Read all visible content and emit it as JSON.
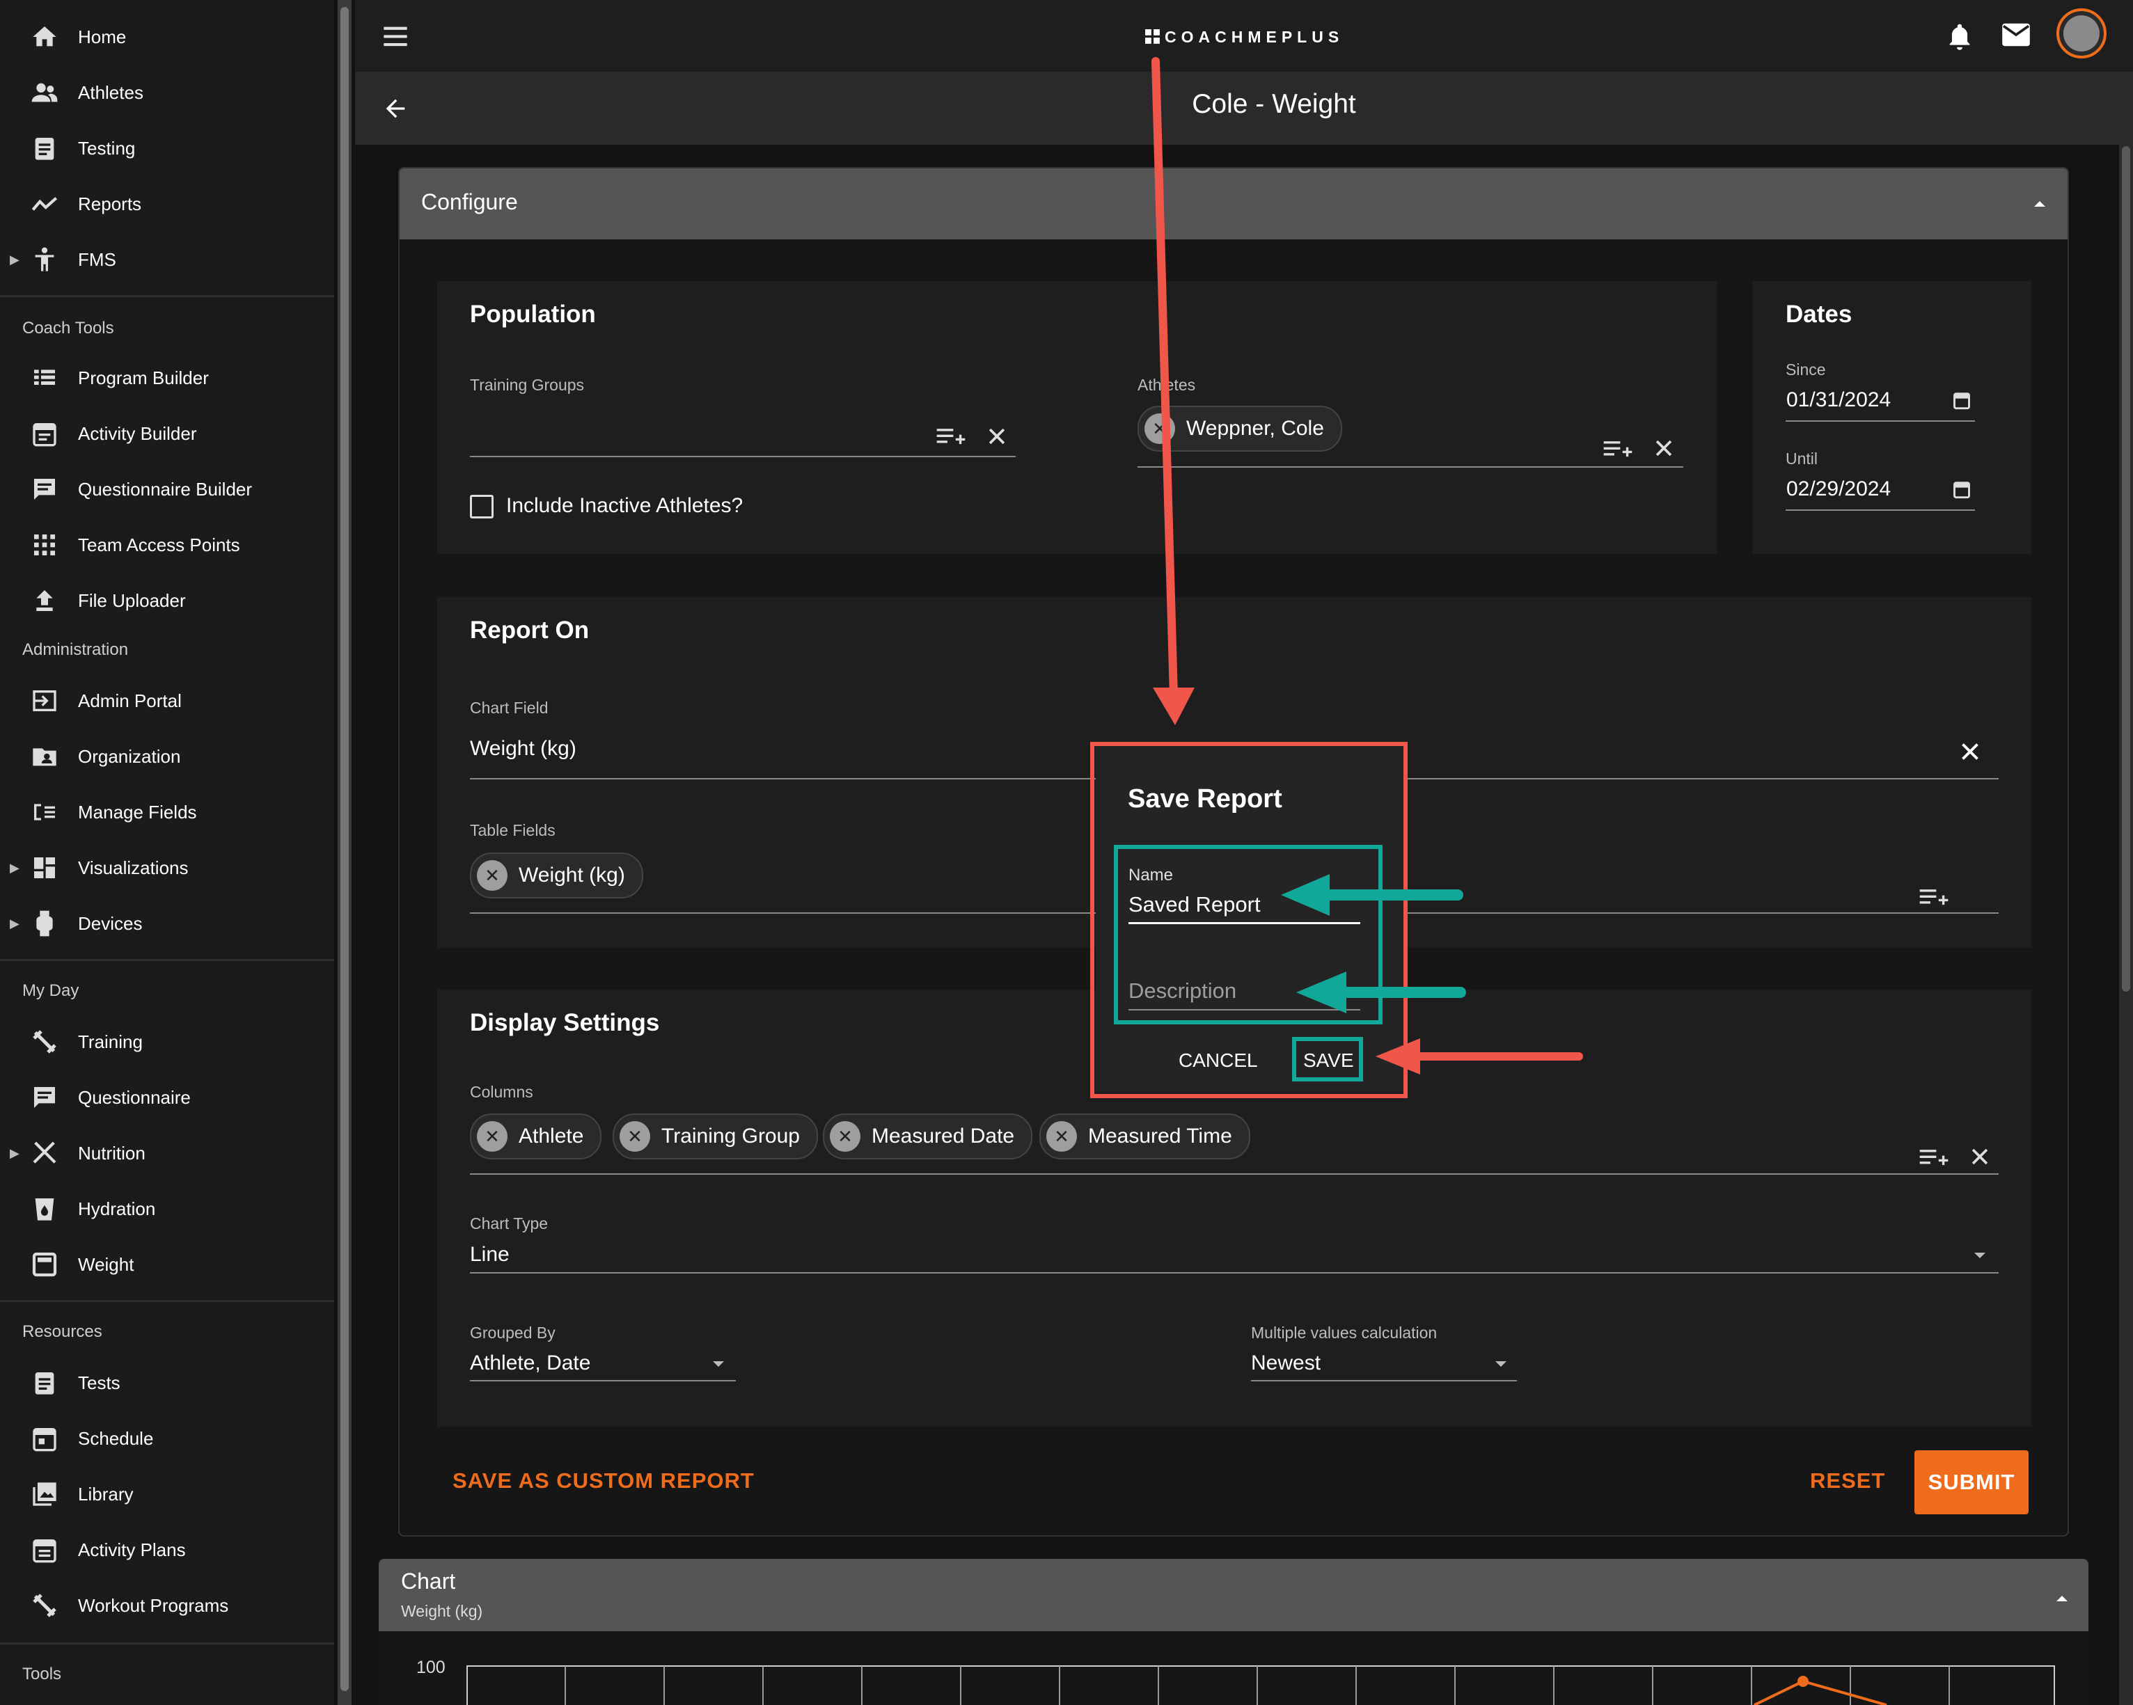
{
  "sidebar": {
    "main_items": [
      {
        "label": "Home",
        "icon": "home-icon"
      },
      {
        "label": "Athletes",
        "icon": "people-icon"
      },
      {
        "label": "Testing",
        "icon": "clipboard-icon"
      },
      {
        "label": "Reports",
        "icon": "trend-icon"
      },
      {
        "label": "FMS",
        "icon": "accessibility-icon"
      }
    ],
    "coach_tools_title": "Coach Tools",
    "coach_tools": [
      {
        "label": "Program Builder",
        "icon": "list-icon"
      },
      {
        "label": "Activity Builder",
        "icon": "calendar-icon"
      },
      {
        "label": "Questionnaire Builder",
        "icon": "comment-icon"
      },
      {
        "label": "Team Access Points",
        "icon": "grid-icon"
      },
      {
        "label": "File Uploader",
        "icon": "upload-icon"
      }
    ],
    "administration_title": "Administration",
    "administration": [
      {
        "label": "Admin Portal",
        "icon": "login-icon"
      },
      {
        "label": "Organization",
        "icon": "folder-person-icon"
      },
      {
        "label": "Manage Fields",
        "icon": "fields-icon"
      },
      {
        "label": "Visualizations",
        "icon": "dashboard-icon"
      },
      {
        "label": "Devices",
        "icon": "watch-icon"
      }
    ],
    "my_day_title": "My Day",
    "my_day": [
      {
        "label": "Training",
        "icon": "dumbbell-icon"
      },
      {
        "label": "Questionnaire",
        "icon": "comment-icon"
      },
      {
        "label": "Nutrition",
        "icon": "utensils-icon"
      },
      {
        "label": "Hydration",
        "icon": "cup-icon"
      },
      {
        "label": "Weight",
        "icon": "scale-icon"
      }
    ],
    "resources_title": "Resources",
    "resources": [
      {
        "label": "Tests",
        "icon": "clipboard-icon"
      },
      {
        "label": "Schedule",
        "icon": "calendar-icon"
      },
      {
        "label": "Library",
        "icon": "photo-library-icon"
      },
      {
        "label": "Activity Plans",
        "icon": "calendar-list-icon"
      },
      {
        "label": "Workout Programs",
        "icon": "dumbbell-icon"
      }
    ],
    "tools_title": "Tools"
  },
  "header": {
    "logo_text": "COACHMEPLUS",
    "page_title": "Cole - Weight"
  },
  "configure": {
    "title": "Configure",
    "population": {
      "title": "Population",
      "training_groups_label": "Training Groups",
      "athletes_label": "Athletes",
      "athlete_chip": "Weppner, Cole",
      "inactive_label": "Include Inactive Athletes?"
    },
    "dates": {
      "title": "Dates",
      "since_label": "Since",
      "since_value": "01/31/2024",
      "until_label": "Until",
      "until_value": "02/29/2024"
    },
    "report_on": {
      "title": "Report On",
      "chart_field_label": "Chart Field",
      "chart_field_value": "Weight (kg)",
      "table_fields_label": "Table Fields",
      "table_chip": "Weight (kg)"
    },
    "display": {
      "title": "Display Settings",
      "columns_label": "Columns",
      "columns": [
        "Athlete",
        "Training Group",
        "Measured Date",
        "Measured Time"
      ],
      "chart_type_label": "Chart Type",
      "chart_type_value": "Line",
      "grouped_by_label": "Grouped By",
      "grouped_by_value": "Athlete, Date",
      "multi_label": "Multiple values calculation",
      "multi_value": "Newest"
    },
    "save_custom_label": "SAVE AS CUSTOM REPORT",
    "reset_label": "RESET",
    "submit_label": "SUBMIT"
  },
  "chart_panel": {
    "title": "Chart",
    "subtitle": "Weight (kg)",
    "y_tick_top": "100"
  },
  "dialog": {
    "title": "Save Report",
    "name_label": "Name",
    "name_value": "Saved Report",
    "description_placeholder": "Description",
    "cancel_label": "CANCEL",
    "save_label": "SAVE"
  },
  "colors": {
    "accent": "#ef6c1c",
    "annotation_red": "#f0564a",
    "annotation_teal": "#12a899"
  }
}
